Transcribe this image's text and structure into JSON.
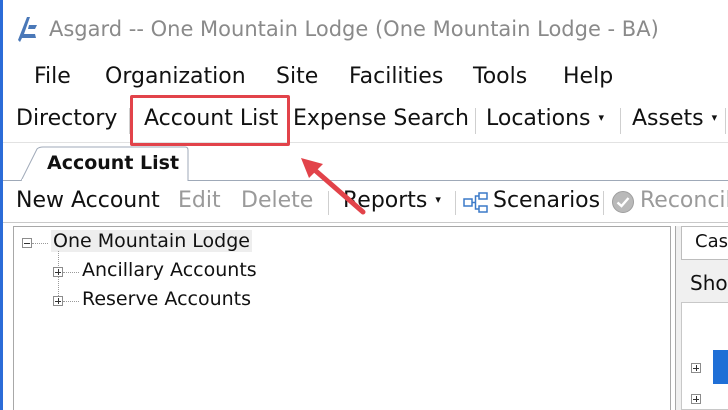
{
  "window": {
    "title": "Asgard -- One Mountain Lodge (One Mountain Lodge - BA)",
    "accent_color": "#2b6cd8"
  },
  "menubar": {
    "items": [
      "File",
      "Organization",
      "Site",
      "Facilities",
      "Tools",
      "Help"
    ]
  },
  "navbar": {
    "items": [
      {
        "label": "Directory",
        "dropdown": false
      },
      {
        "label": "Account List",
        "dropdown": false,
        "highlighted": true
      },
      {
        "label": "Expense Search",
        "dropdown": false
      },
      {
        "label": "Locations",
        "dropdown": true
      },
      {
        "label": "Assets",
        "dropdown": true
      }
    ],
    "dropdown_glyph": "▾"
  },
  "document_tab": {
    "label": "Account List"
  },
  "toolbar": {
    "new_account": "New Account",
    "edit": "Edit",
    "delete": "Delete",
    "reports": "Reports",
    "scenarios": "Scenarios",
    "reconcile": "Reconcil",
    "icons": {
      "scenarios": "hierarchy-icon",
      "reconcile": "check-circle-icon"
    }
  },
  "tree": {
    "root": {
      "label": "One Mountain Lodge",
      "expanded": true
    },
    "children": [
      {
        "label": "Ancillary Accounts",
        "expanded": false
      },
      {
        "label": "Reserve Accounts",
        "expanded": false
      }
    ]
  },
  "right_panel": {
    "tab_label": "Cas",
    "show_label": "Shov"
  },
  "annotation": {
    "color": "#e2434a"
  }
}
